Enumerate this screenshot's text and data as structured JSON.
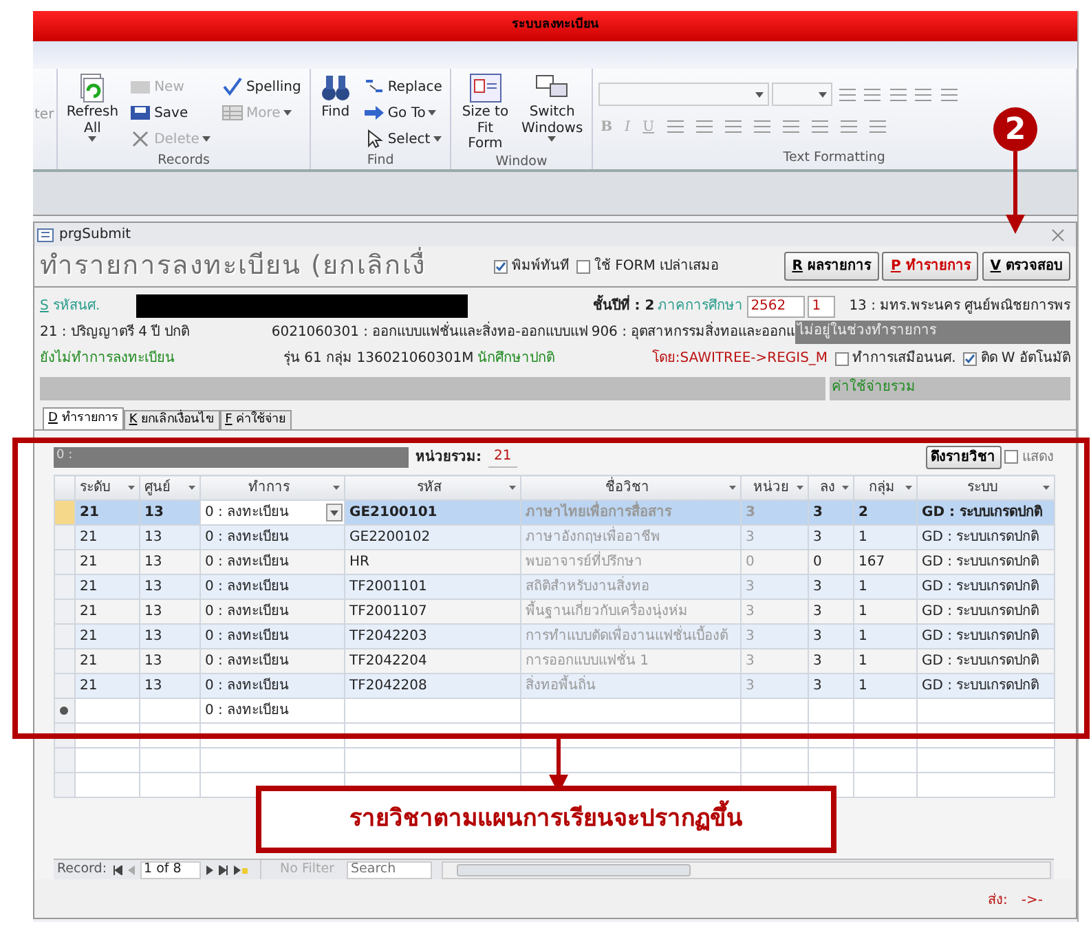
{
  "title_bar": {
    "title": "ระบบลงทะเบียน"
  },
  "ribbon": {
    "cut_label": "ter",
    "groups": [
      {
        "label": "Records",
        "items": [
          {
            "label": "Refresh All",
            "kind": "large",
            "disabled": false,
            "dropdown": true
          },
          {
            "label": "New",
            "kind": "small",
            "disabled": true,
            "dropdown": false
          },
          {
            "label": "Save",
            "kind": "small",
            "disabled": false,
            "dropdown": false
          },
          {
            "label": "Delete",
            "kind": "small",
            "disabled": true,
            "dropdown": true
          },
          {
            "label": "Spelling",
            "kind": "small",
            "disabled": false,
            "dropdown": false
          },
          {
            "label": "More",
            "kind": "small",
            "disabled": true,
            "dropdown": true
          }
        ]
      },
      {
        "label": "Find",
        "items": [
          {
            "label": "Find",
            "kind": "large",
            "disabled": false,
            "dropdown": false
          },
          {
            "label": "Replace",
            "kind": "small",
            "disabled": false,
            "dropdown": false
          },
          {
            "label": "Go To",
            "kind": "small",
            "disabled": false,
            "dropdown": true
          },
          {
            "label": "Select",
            "kind": "small",
            "disabled": false,
            "dropdown": true
          }
        ]
      },
      {
        "label": "Window",
        "items": [
          {
            "label": "Size to Fit Form",
            "kind": "large",
            "disabled": false,
            "dropdown": false
          },
          {
            "label": "Switch Windows",
            "kind": "large",
            "disabled": false,
            "dropdown": true
          }
        ]
      },
      {
        "label": "Text Formatting",
        "format_buttons": [
          "B",
          "I",
          "U"
        ]
      }
    ]
  },
  "form": {
    "title": "prgSubmit",
    "heading": "ทำรายการลงทะเบียน (ยกเลิกเงื่",
    "options": [
      {
        "label": "พิมพ์ทันที",
        "checked": true
      },
      {
        "label": "ใช้ FORM เปล่าเสมอ",
        "checked": false
      }
    ],
    "buttons": [
      {
        "key": "R",
        "label": "ผลรายการ",
        "kind": "normal"
      },
      {
        "key": "P",
        "label": "ทำรายการ",
        "kind": "alert"
      },
      {
        "key": "V",
        "label": "ตรวจสอบ",
        "kind": "normal"
      }
    ],
    "student_link": {
      "key": "S",
      "label": "รหัสนศ."
    },
    "year": "ชั้นปีที่ : 2",
    "term_label": "ภาคการศึกษา",
    "term_year": "2562",
    "term": "1",
    "campus": "13 : มทร.พระนคร ศูนย์พณิชยการพร",
    "level": "21 : ปริญญาตรี 4 ปี ปกติ",
    "program": "6021060301 : ออกแบบแฟชั่นและสิ่งทอ-ออกแบบแฟ",
    "faculty": "906 : อุตสาหกรรมสิ่งทอและออกแ",
    "period_notice": "ไม่อยู่ในช่วงทำรายการ",
    "reg_status": "ยังไม่ทำการลงทะเบียน",
    "cohort": "รุ่น 61 กลุ่ม 136021060301M",
    "student_type": "นักศึกษาปกติ",
    "by": "โดย:SAWITREE->REGIS_M",
    "flags": [
      {
        "label": "ทำการเสมือนนศ.",
        "checked": false
      },
      {
        "label": "ติด W อัตโนมัติ",
        "checked": true
      }
    ],
    "total_cost_label": "ค่าใช้จ่ายรวม",
    "tabs": [
      {
        "key": "D",
        "label": "ทำรายการ",
        "selected": true
      },
      {
        "key": "K",
        "label": "ยกเลิกเงื่อนไข",
        "selected": false
      },
      {
        "key": "F",
        "label": "ค่าใช้จ่าย",
        "selected": false
      }
    ]
  },
  "subform": {
    "bar": "0 :",
    "units_label": "หน่วยรวม:",
    "units": "21",
    "fetch_button": "ดึงรายวิชา",
    "show": {
      "label": "แสดง",
      "checked": false
    },
    "columns": [
      {
        "label": "ระดับ",
        "disabled": false
      },
      {
        "label": "ศูนย์",
        "disabled": false
      },
      {
        "label": "ทำการ",
        "disabled": false
      },
      {
        "label": "รหัส",
        "disabled": false
      },
      {
        "label": "ชื่อวิชา",
        "disabled": true
      },
      {
        "label": "หน่วย",
        "disabled": true
      },
      {
        "label": "ลง",
        "disabled": false
      },
      {
        "label": "กลุ่ม",
        "disabled": false
      },
      {
        "label": "ระบบ",
        "disabled": false
      }
    ],
    "rows": [
      {
        "selected": true,
        "cells": [
          "21",
          "13",
          "0 : ลงทะเบียน",
          "GE2100101",
          "ภาษาไทยเพื่อการสื่อสาร",
          "3",
          "3",
          "2",
          "GD : ระบบเกรดปกติ"
        ]
      },
      {
        "selected": false,
        "cells": [
          "21",
          "13",
          "0 : ลงทะเบียน",
          "GE2200102",
          "ภาษาอังกฤษเพื่ออาชีพ",
          "3",
          "3",
          "1",
          "GD : ระบบเกรดปกติ"
        ]
      },
      {
        "selected": false,
        "cells": [
          "21",
          "13",
          "0 : ลงทะเบียน",
          "HR",
          "พบอาจารย์ที่ปรึกษา",
          "0",
          "0",
          "167",
          "GD : ระบบเกรดปกติ"
        ]
      },
      {
        "selected": false,
        "cells": [
          "21",
          "13",
          "0 : ลงทะเบียน",
          "TF2001101",
          "สถิติสำหรับงานสิ่งทอ",
          "3",
          "3",
          "1",
          "GD : ระบบเกรดปกติ"
        ]
      },
      {
        "selected": false,
        "cells": [
          "21",
          "13",
          "0 : ลงทะเบียน",
          "TF2001107",
          "พื้นฐานเกี่ยวกับเครื่องนุ่งห่ม",
          "3",
          "3",
          "1",
          "GD : ระบบเกรดปกติ"
        ]
      },
      {
        "selected": false,
        "cells": [
          "21",
          "13",
          "0 : ลงทะเบียน",
          "TF2042203",
          "การทำแบบตัดเพื่องานแฟชั่นเบื้องต้",
          "3",
          "3",
          "1",
          "GD : ระบบเกรดปกติ"
        ]
      },
      {
        "selected": false,
        "cells": [
          "21",
          "13",
          "0 : ลงทะเบียน",
          "TF2042204",
          "การออกแบบแฟชั่น 1",
          "3",
          "3",
          "1",
          "GD : ระบบเกรดปกติ"
        ]
      },
      {
        "selected": false,
        "cells": [
          "21",
          "13",
          "0 : ลงทะเบียน",
          "TF2042208",
          "สิ่งทอพื้นถิ่น",
          "3",
          "3",
          "1",
          "GD : ระบบเกรดปกติ"
        ]
      }
    ],
    "new_row": {
      "action": "0 : ลงทะเบียน"
    },
    "navigator": {
      "label": "Record:",
      "position": "1 of 8",
      "filter": "No Filter",
      "search_placeholder": "Search"
    }
  },
  "footer": {
    "send_label": "ส่ง:",
    "send_value": "->-"
  },
  "annotations": {
    "step": "2",
    "callout": "รายวิชาตามแผนการเรียนจะปรากฏขึ้น"
  }
}
